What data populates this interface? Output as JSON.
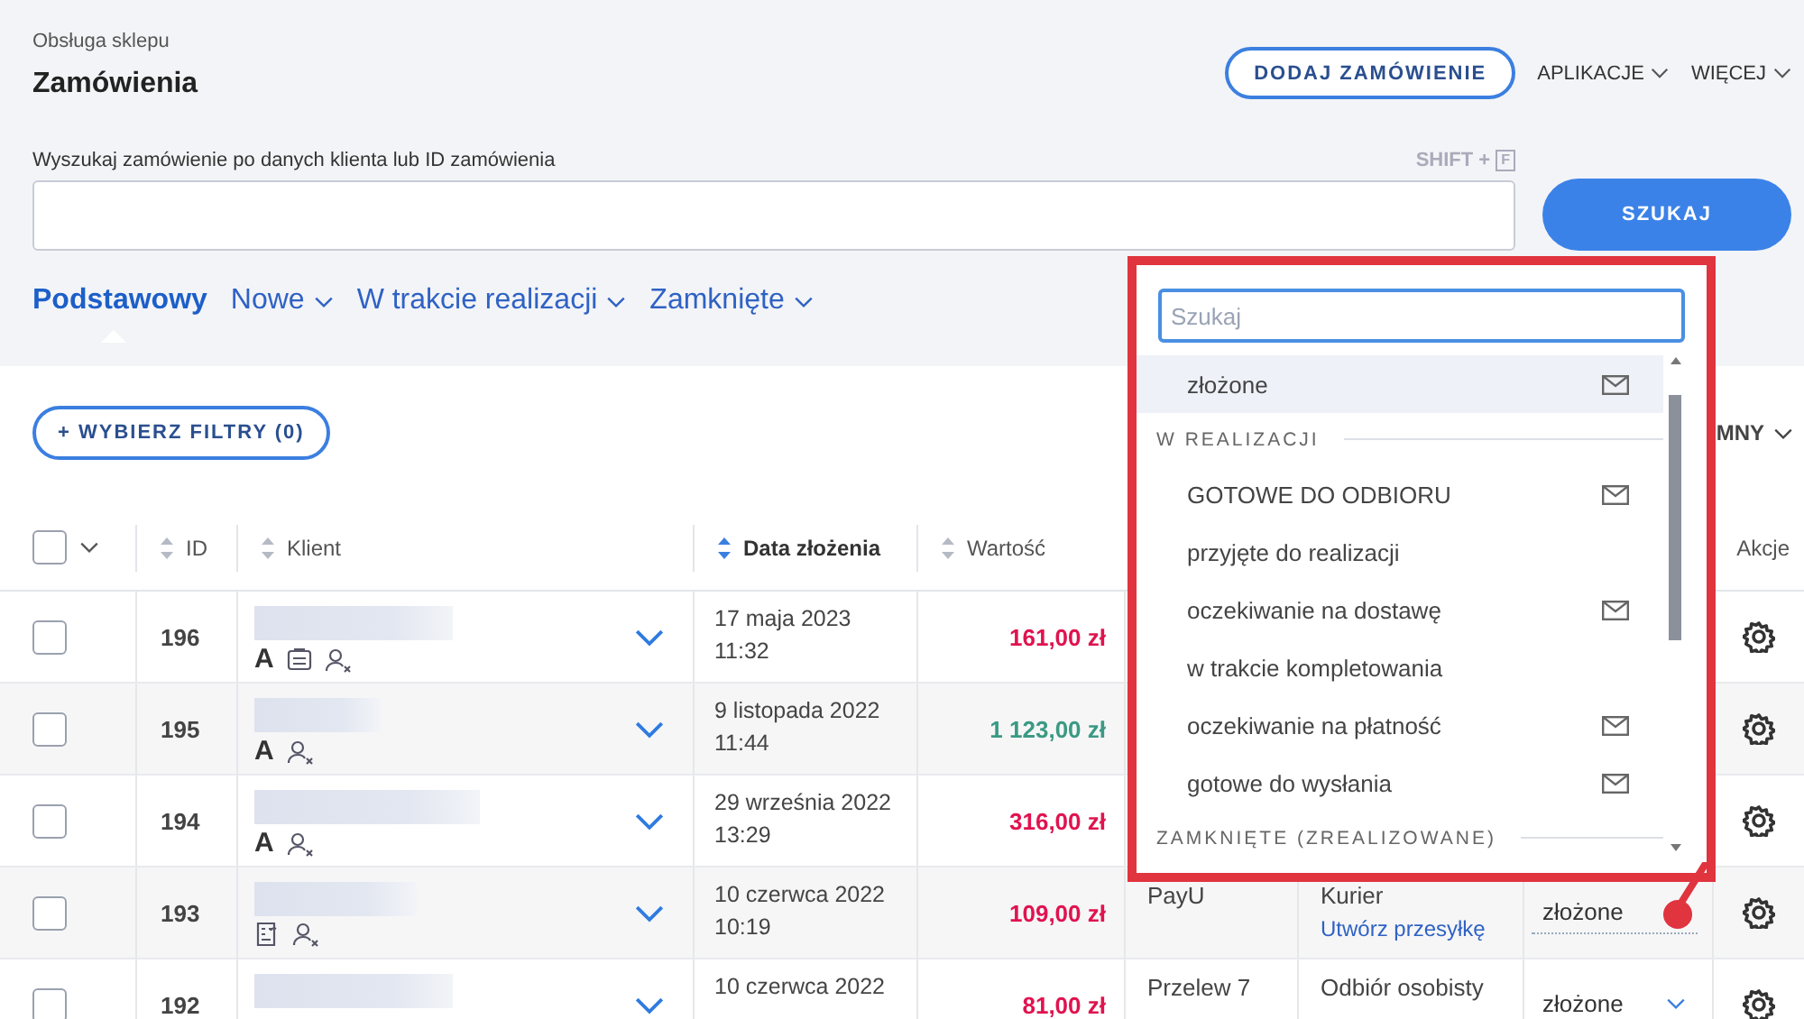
{
  "breadcrumb": "Obsługa sklepu",
  "title": "Zamówienia",
  "header_actions": [
    {
      "kind": "button",
      "label": "DODAJ ZAMÓWIENIE"
    },
    {
      "kind": "menu",
      "label": "APLIKACJE"
    },
    {
      "kind": "menu",
      "label": "WIĘCEJ"
    }
  ],
  "search": {
    "label": "Wyszukaj zamówienie po danych klienta lub ID zamówienia",
    "shortcut": "SHIFT +",
    "shortcut_key": "F",
    "button": "SZUKAJ"
  },
  "tabs": [
    {
      "label": "Podstawowy",
      "selected": true,
      "menu": false
    },
    {
      "label": "Nowe",
      "selected": false,
      "menu": true
    },
    {
      "label": "W trakcie realizacji",
      "selected": false,
      "menu": true
    },
    {
      "label": "Zamknięte",
      "selected": false,
      "menu": true
    }
  ],
  "filters_button": "+ WYBIERZ FILTRY (0)",
  "columns_menu": "MNY",
  "table": {
    "select_all_checked": false,
    "columns": [
      {
        "label": "ID",
        "sorted": false
      },
      {
        "label": "Klient",
        "sorted": false
      },
      {
        "label": "Data złożenia",
        "sorted": true
      },
      {
        "label": "Wartość",
        "sorted": false
      },
      {
        "label": "Akcje"
      }
    ],
    "rows": [
      {
        "id": "196",
        "checked": false,
        "badges": [
          {
            "kind": "letter",
            "text": "A"
          },
          {
            "kind": "document"
          },
          {
            "kind": "user"
          }
        ],
        "date": "17 maja 2023",
        "time": "11:32",
        "value": "161,00 zł",
        "color": "#e0134f"
      },
      {
        "id": "195",
        "checked": false,
        "badges": [
          {
            "kind": "letter",
            "text": "A"
          },
          {
            "kind": "user"
          }
        ],
        "date": "9 listopada 2022",
        "time": "11:44",
        "value": "1 123,00 zł",
        "color": "#3a9a84"
      },
      {
        "id": "194",
        "checked": false,
        "badges": [
          {
            "kind": "letter",
            "text": "A"
          },
          {
            "kind": "user"
          }
        ],
        "date": "29 września 2022",
        "time": "13:29",
        "value": "316,00 zł",
        "color": "#e0134f"
      },
      {
        "id": "193",
        "checked": false,
        "badges": [
          {
            "kind": "invoice"
          },
          {
            "kind": "user"
          }
        ],
        "date": "10 czerwca 2022",
        "time": "10:19",
        "value": "109,00 zł",
        "color": "#e0134f",
        "payment": "PayU",
        "delivery": "Kurier",
        "shipment_link": "Utwórz przesyłkę",
        "status": "złożone"
      },
      {
        "id": "192",
        "checked": false,
        "badges": [],
        "date": "10 czerwca 2022",
        "value": "81,00 zł",
        "color": "#e0134f",
        "payment": "Przelew 7",
        "delivery": "Odbiór osobisty",
        "status": "złożone",
        "status_menu": true
      }
    ]
  },
  "status_dropdown": {
    "placeholder": "Szukaj",
    "items": [
      {
        "kind": "option",
        "label": "złożone",
        "mail": true,
        "selected": true
      },
      {
        "kind": "group",
        "label": "W REALIZACJI"
      },
      {
        "kind": "option",
        "label": "GOTOWE DO ODBIORU",
        "mail": true,
        "selected": false
      },
      {
        "kind": "option",
        "label": "przyjęte do realizacji",
        "mail": false,
        "selected": false
      },
      {
        "kind": "option",
        "label": "oczekiwanie na dostawę",
        "mail": true,
        "selected": false
      },
      {
        "kind": "option",
        "label": "w trakcie kompletowania",
        "mail": false,
        "selected": false
      },
      {
        "kind": "option",
        "label": "oczekiwanie na płatność",
        "mail": true,
        "selected": false
      },
      {
        "kind": "option",
        "label": "gotowe do wysłania",
        "mail": true,
        "selected": false
      },
      {
        "kind": "group",
        "label": "ZAMKNIĘTE (ZREALIZOWANE)"
      }
    ]
  }
}
